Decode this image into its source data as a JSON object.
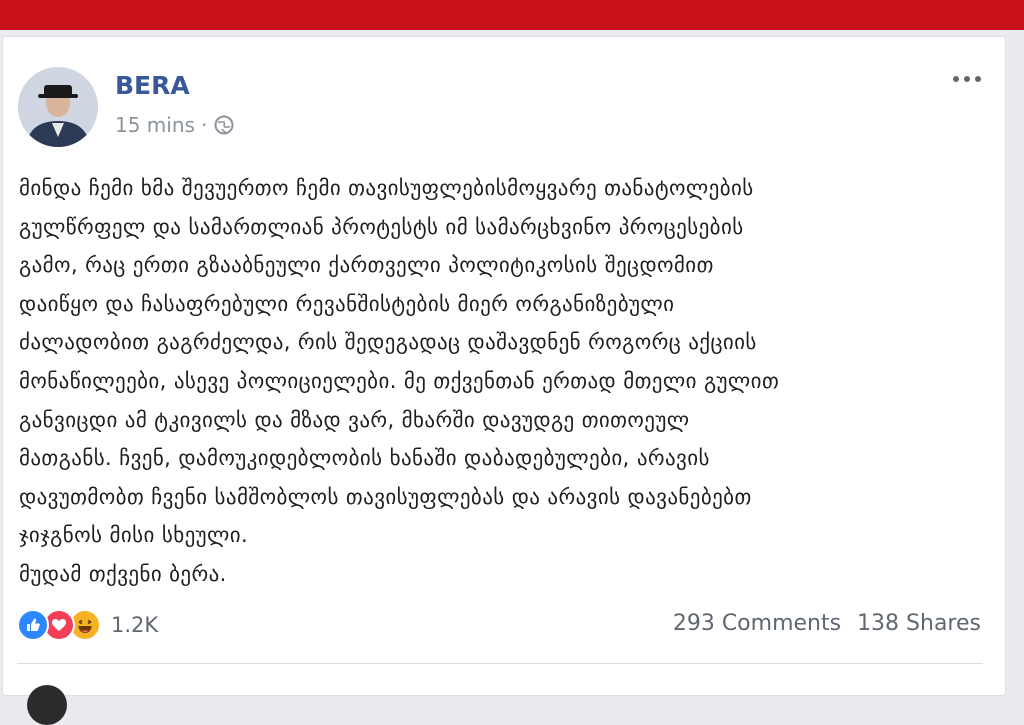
{
  "post": {
    "author": "BERA",
    "time": "15 mins",
    "dot": "·",
    "body_lines": [
      "მინდა ჩემი ხმა შევუერთო ჩემი თავისუფლებისმოყვარე თანატოლების",
      "გულწრფელ და სამართლიან პროტესტს იმ სამარცხვინო პროცესების",
      "გამო, რაც ერთი გზააბნეული ქართველი პოლიტიკოსის შეცდომით",
      "დაიწყო და ჩასაფრებული რევანშისტების მიერ ორგანიზებული",
      "ძალადობით გაგრძელდა, რის შედეგადაც დაშავდნენ როგორც აქციის",
      "მონაწილეები, ასევე პოლიციელები. მე თქვენთან ერთად მთელი გულით",
      "განვიცდი ამ ტკივილს და მზად ვარ, მხარში დავუდგე თითოეულ",
      "მათგანს. ჩვენ, დამოუკიდებლობის ხანაში დაბადებულები, არავის",
      "დავუთმობთ ჩვენი სამშობლოს თავისუფლებას და არავის დავანებებთ",
      "ჯიჯგნოს მისი სხეული.",
      "მუდამ თქვენი ბერა."
    ]
  },
  "footer": {
    "reaction_count": "1.2K",
    "comments": "293 Comments",
    "shares": "138 Shares"
  },
  "icons": {
    "reactions": [
      "like-icon",
      "love-icon",
      "haha-icon"
    ],
    "privacy": "globe-icon",
    "menu": "more-options-icon"
  },
  "colors": {
    "top_bar": "#c8101a",
    "author_link": "#385898",
    "like": "#2d88ff",
    "love": "#f33e58",
    "haha": "#f7b125"
  }
}
